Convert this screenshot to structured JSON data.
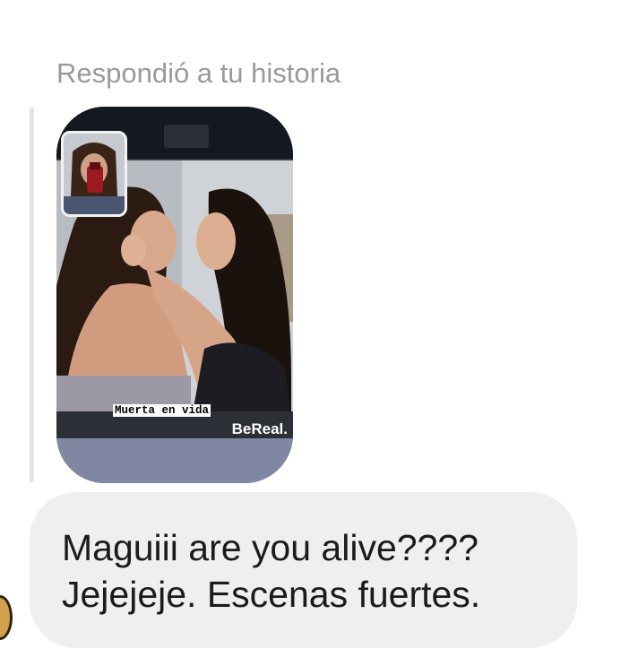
{
  "header": {
    "reply_label": "Respondió a tu historia"
  },
  "story": {
    "caption": "Muerta en vida",
    "brand": "BeReal."
  },
  "message": {
    "line1": "Maguiii are you alive????",
    "line2": "Jejejeje. Escenas fuertes."
  },
  "colors": {
    "bubble": "#efefef",
    "label": "#9a9a9a",
    "quote_bar": "#e3e3e3",
    "text": "#1b1b1b"
  }
}
